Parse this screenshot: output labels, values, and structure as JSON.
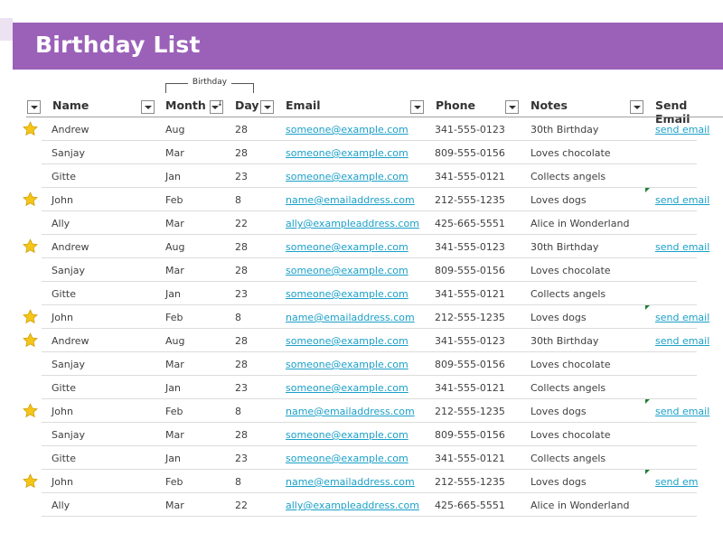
{
  "title": "Birthday List",
  "group_label": "Birthday",
  "columns": {
    "name": "Name",
    "month": "Month",
    "day": "Day",
    "email": "Email",
    "phone": "Phone",
    "notes": "Notes",
    "send_email": "Send Email"
  },
  "rows": [
    {
      "star": true,
      "name": "Andrew",
      "month": "Aug",
      "day": "28",
      "email": "someone@example.com",
      "phone": "341-555-0123",
      "notes": "30th Birthday",
      "send": "send email",
      "flag": false
    },
    {
      "star": false,
      "name": "Sanjay",
      "month": "Mar",
      "day": "28",
      "email": "someone@example.com",
      "phone": "809-555-0156",
      "notes": "Loves chocolate",
      "send": "",
      "flag": false
    },
    {
      "star": false,
      "name": "Gitte",
      "month": "Jan",
      "day": "23",
      "email": "someone@example.com",
      "phone": "341-555-0121",
      "notes": "Collects angels",
      "send": "",
      "flag": false
    },
    {
      "star": true,
      "name": "John",
      "month": "Feb",
      "day": "8",
      "email": "name@emailaddress.com",
      "phone": "212-555-1235",
      "notes": "Loves dogs",
      "send": "send email",
      "flag": true
    },
    {
      "star": false,
      "name": "Ally",
      "month": "Mar",
      "day": "22",
      "email": "ally@exampleaddress.com",
      "phone": "425-665-5551",
      "notes": "Alice in Wonderland",
      "send": "",
      "flag": false
    },
    {
      "star": true,
      "name": "Andrew",
      "month": "Aug",
      "day": "28",
      "email": "someone@example.com",
      "phone": "341-555-0123",
      "notes": "30th Birthday",
      "send": "send email",
      "flag": false
    },
    {
      "star": false,
      "name": "Sanjay",
      "month": "Mar",
      "day": "28",
      "email": "someone@example.com",
      "phone": "809-555-0156",
      "notes": "Loves chocolate",
      "send": "",
      "flag": false
    },
    {
      "star": false,
      "name": "Gitte",
      "month": "Jan",
      "day": "23",
      "email": "someone@example.com",
      "phone": "341-555-0121",
      "notes": "Collects angels",
      "send": "",
      "flag": false
    },
    {
      "star": true,
      "name": "John",
      "month": "Feb",
      "day": "8",
      "email": "name@emailaddress.com",
      "phone": "212-555-1235",
      "notes": "Loves dogs",
      "send": "send email",
      "flag": true
    },
    {
      "star": true,
      "name": "Andrew",
      "month": "Aug",
      "day": "28",
      "email": "someone@example.com",
      "phone": "341-555-0123",
      "notes": "30th Birthday",
      "send": "send email",
      "flag": false
    },
    {
      "star": false,
      "name": "Sanjay",
      "month": "Mar",
      "day": "28",
      "email": "someone@example.com",
      "phone": "809-555-0156",
      "notes": "Loves chocolate",
      "send": "",
      "flag": false
    },
    {
      "star": false,
      "name": "Gitte",
      "month": "Jan",
      "day": "23",
      "email": "someone@example.com",
      "phone": "341-555-0121",
      "notes": "Collects angels",
      "send": "",
      "flag": false
    },
    {
      "star": true,
      "name": "John",
      "month": "Feb",
      "day": "8",
      "email": "name@emailaddress.com",
      "phone": "212-555-1235",
      "notes": "Loves dogs",
      "send": "send email",
      "flag": true
    },
    {
      "star": false,
      "name": "Sanjay",
      "month": "Mar",
      "day": "28",
      "email": "someone@example.com",
      "phone": "809-555-0156",
      "notes": "Loves chocolate",
      "send": "",
      "flag": false
    },
    {
      "star": false,
      "name": "Gitte",
      "month": "Jan",
      "day": "23",
      "email": "someone@example.com",
      "phone": "341-555-0121",
      "notes": "Collects angels",
      "send": "",
      "flag": false
    },
    {
      "star": true,
      "name": "John",
      "month": "Feb",
      "day": "8",
      "email": "name@emailaddress.com",
      "phone": "212-555-1235",
      "notes": "Loves dogs",
      "send": "send em",
      "flag": true
    },
    {
      "star": false,
      "name": "Ally",
      "month": "Mar",
      "day": "22",
      "email": "ally@exampleaddress.com",
      "phone": "425-665-5551",
      "notes": "Alice in Wonderland",
      "send": "",
      "flag": false
    }
  ],
  "colors": {
    "title_bar": "#9b61b8",
    "link": "#1aa0c9",
    "star": "#f5c518"
  }
}
